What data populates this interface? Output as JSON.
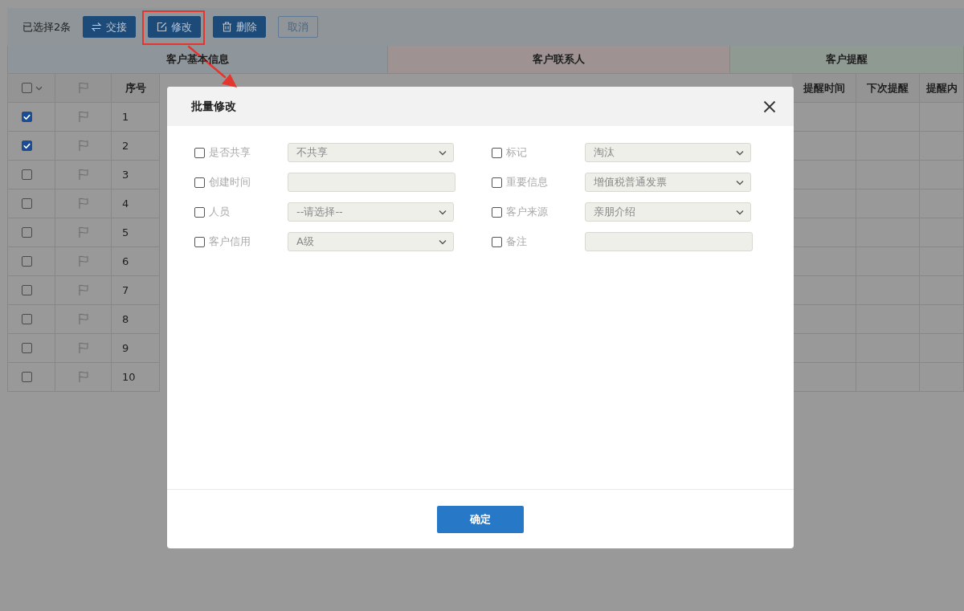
{
  "toolbar": {
    "selection": "已选择2条",
    "buttons": [
      {
        "label": "交接",
        "kind": "transfer",
        "highlighted": false
      },
      {
        "label": "修改",
        "kind": "edit",
        "highlighted": true
      },
      {
        "label": "删除",
        "kind": "delete",
        "highlighted": false
      },
      {
        "label": "取消",
        "kind": "cancel",
        "highlighted": false
      }
    ]
  },
  "table": {
    "groups": [
      {
        "label": "客户基本信息",
        "color": "#8e959b"
      },
      {
        "label": "客户联系人",
        "color": "#9e9292"
      },
      {
        "label": "客户提醒",
        "color": "#8f9a92"
      }
    ],
    "left_columns": [
      {
        "kind": "checkbox",
        "checked": false
      },
      {
        "kind": "flag"
      },
      {
        "kind": "text",
        "label": "序号"
      }
    ],
    "right_columns": [
      {
        "label": "提醒时间"
      },
      {
        "label": "下次提醒"
      },
      {
        "label": "提醒内"
      }
    ],
    "rows": [
      {
        "checked": true,
        "number": "1"
      },
      {
        "checked": true,
        "number": "2"
      },
      {
        "checked": false,
        "number": "3"
      },
      {
        "checked": false,
        "number": "4"
      },
      {
        "checked": false,
        "number": "5"
      },
      {
        "checked": false,
        "number": "6"
      },
      {
        "checked": false,
        "number": "7"
      },
      {
        "checked": false,
        "number": "8"
      },
      {
        "checked": false,
        "number": "9"
      },
      {
        "checked": false,
        "number": "10"
      }
    ]
  },
  "modal": {
    "title": "批量修改",
    "fields": [
      {
        "label": "是否共享",
        "checked": false,
        "kind": "select",
        "value": "不共享"
      },
      {
        "label": "标记",
        "checked": false,
        "kind": "select",
        "value": "淘汰"
      },
      {
        "label": "创建时间",
        "checked": false,
        "kind": "input"
      },
      {
        "label": "重要信息",
        "checked": false,
        "kind": "select",
        "value": "增值税普通发票"
      },
      {
        "label": "人员",
        "checked": false,
        "kind": "select",
        "value": "--请选择--"
      },
      {
        "label": "客户来源",
        "checked": false,
        "kind": "select",
        "value": "亲朋介绍"
      },
      {
        "label": "客户信用",
        "checked": false,
        "kind": "select",
        "value": "A级"
      },
      {
        "label": "备注",
        "checked": false,
        "kind": "input"
      }
    ],
    "confirm": "确定"
  }
}
